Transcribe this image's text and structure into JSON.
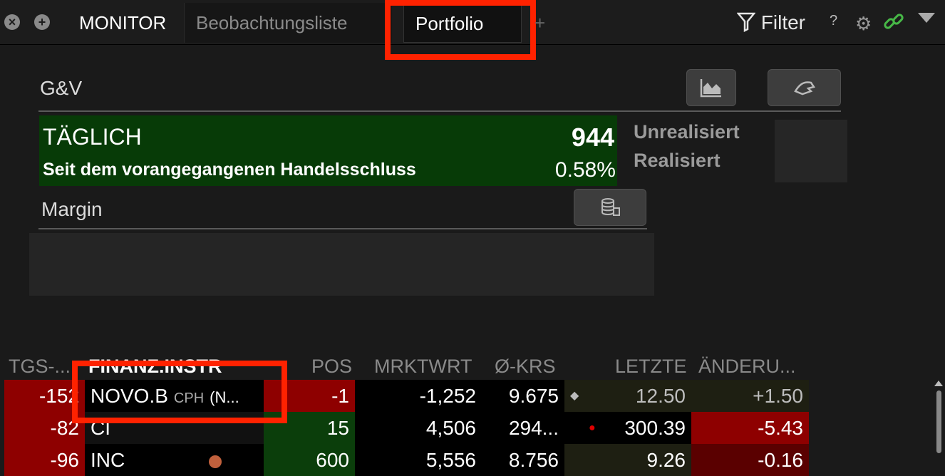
{
  "tabs": {
    "monitor": "MONITOR",
    "watchlist": "Beobachtungsliste",
    "portfolio": "Portfolio",
    "add": "+"
  },
  "toolbar": {
    "filter_label": "Filter",
    "help": "?"
  },
  "pnl": {
    "section_label": "G&V",
    "daily_label": "TÄGLICH",
    "daily_value": "944",
    "since_label": "Seit dem vorangegangenen Handelsschluss",
    "since_pct": "0.58%",
    "unrealized_label": "Unrealisiert",
    "realized_label": "Realisiert"
  },
  "margin": {
    "label": "Margin"
  },
  "table": {
    "headers": [
      "TGS-...",
      "FINANZ.INSTR",
      "POS",
      "MRKTWRT",
      "Ø-KRS",
      "LETZTE",
      "ÄNDERU..."
    ],
    "rows": [
      {
        "daily": "-152",
        "symbol": "NOVO.B",
        "exchange": "CPH",
        "more": "(N...",
        "pos": "-1",
        "mktval": "-1,252",
        "avg": "9.675",
        "last_marker": "◆",
        "last": "12.50",
        "change": "+1.50"
      },
      {
        "daily": "-82",
        "symbol": "CI",
        "exchange": "",
        "more": "",
        "pos": "15",
        "mktval": "4,506",
        "avg": "294...",
        "last_marker": "●",
        "last": "300.39",
        "change": "-5.43"
      },
      {
        "daily": "-96",
        "symbol": "INC",
        "exchange": "",
        "more": "",
        "pos": "600",
        "mktval": "5,556",
        "avg": "8.756",
        "last_marker": "",
        "last": "9.26",
        "change": "-0.16"
      }
    ]
  },
  "colors": {
    "accent_green": "#073b07",
    "negative_red": "#8e0000",
    "highlight": "#ff2200"
  },
  "icons": [
    "close-icon",
    "add-icon",
    "filter-icon",
    "gear-icon",
    "link-icon",
    "chevron-down-icon",
    "area-chart-icon",
    "hand-icon",
    "coins-icon"
  ]
}
